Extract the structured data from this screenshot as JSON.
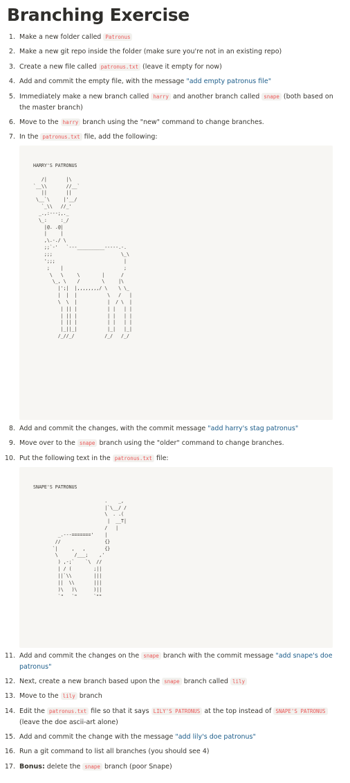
{
  "title": "Branching Exercise",
  "steps": [
    {
      "number": "1.",
      "parts": [
        {
          "t": "Make a new folder called "
        },
        {
          "t": "Patronus",
          "s": "code"
        }
      ]
    },
    {
      "number": "2.",
      "parts": [
        {
          "t": "Make a new git repo inside the folder (make sure you're not in an existing repo)"
        }
      ]
    },
    {
      "number": "3.",
      "parts": [
        {
          "t": "Create a new file called "
        },
        {
          "t": "patronus.txt",
          "s": "code"
        },
        {
          "t": " (leave it empty for now)"
        }
      ]
    },
    {
      "number": "4.",
      "parts": [
        {
          "t": "Add and commit the empty file, with the message "
        },
        {
          "t": "\"add empty patronus file\"",
          "s": "quote"
        }
      ]
    },
    {
      "number": "5.",
      "parts": [
        {
          "t": "Immediately make a new branch called "
        },
        {
          "t": "harry",
          "s": "code"
        },
        {
          "t": " and another branch called "
        },
        {
          "t": "snape",
          "s": "code"
        },
        {
          "t": " (both based on the master branch)"
        }
      ]
    },
    {
      "number": "6.",
      "parts": [
        {
          "t": "Move to the "
        },
        {
          "t": "harry",
          "s": "code"
        },
        {
          "t": " branch using the \"new\" command to change branches."
        }
      ]
    },
    {
      "number": "7.",
      "parts": [
        {
          "t": "In the "
        },
        {
          "t": "patronus.txt",
          "s": "code"
        },
        {
          "t": " file, add the following:"
        }
      ]
    },
    {
      "number": "8.",
      "parts": [
        {
          "t": "Add and commit the changes, with the commit message "
        },
        {
          "t": "\"add harry's stag patronus\"",
          "s": "quote"
        }
      ]
    },
    {
      "number": "9.",
      "parts": [
        {
          "t": "Move over to the "
        },
        {
          "t": "snape",
          "s": "code"
        },
        {
          "t": " branch using the \"older\" command to change branches."
        }
      ]
    },
    {
      "number": "10.",
      "parts": [
        {
          "t": "Put the following text in  the "
        },
        {
          "t": "patronus.txt",
          "s": "code"
        },
        {
          "t": " file:"
        }
      ]
    },
    {
      "number": "11.",
      "parts": [
        {
          "t": "Add and commit the changes on the "
        },
        {
          "t": "snape",
          "s": "code"
        },
        {
          "t": " branch with the commit message "
        },
        {
          "t": "\"add snape's doe patronus\"",
          "s": "quote"
        }
      ]
    },
    {
      "number": "12.",
      "parts": [
        {
          "t": "Next, create a new branch based upon the "
        },
        {
          "t": "snape",
          "s": "code"
        },
        {
          "t": " branch called "
        },
        {
          "t": "lily",
          "s": "code"
        }
      ]
    },
    {
      "number": "13.",
      "parts": [
        {
          "t": "Move to the "
        },
        {
          "t": "lily",
          "s": "code"
        },
        {
          "t": " branch"
        }
      ]
    },
    {
      "number": "14.",
      "parts": [
        {
          "t": "Edit the "
        },
        {
          "t": "patronus.txt",
          "s": "code"
        },
        {
          "t": " file so that it says "
        },
        {
          "t": "LILY'S PATRONUS",
          "s": "code"
        },
        {
          "t": " at the top instead of "
        },
        {
          "t": "SNAPE'S PATRONUS",
          "s": "code"
        },
        {
          "t": " (leave the doe ascii-art alone)"
        }
      ]
    },
    {
      "number": "15.",
      "parts": [
        {
          "t": "Add and commit the change with the message "
        },
        {
          "t": "\"add lily's doe patronus\"",
          "s": "quote"
        }
      ]
    },
    {
      "number": "16.",
      "parts": [
        {
          "t": "Run a git command to list all branches (you should see 4)"
        }
      ]
    },
    {
      "number": "17.",
      "parts": [
        {
          "t": "Bonus:",
          "s": "bold"
        },
        {
          "t": " delete the "
        },
        {
          "t": "snape",
          "s": "code"
        },
        {
          "t": " branch (poor Snape)"
        }
      ]
    }
  ],
  "code_blocks": [
    {
      "text": "HARRY'S PATRONUS\n\n   /|       |\\\n`__\\\\       //__`\n   ||       ||\n \\__`\\     |'__/\n   `_\\\\   //_'\n  _.,:---;,._\n  \\_:     :_/\n    |@. .@|\n    |     |\n    ,\\.-./ \\\n    ;;`-'   `---__________-----.-.\n    ;;;                         \\_\\\n    ';;;                         |\n     ;    |                      ;\n      \\   \\     \\        |      /\n       \\_, \\    /        \\     |\\\n         |';|  |,,,,,,,,/ \\    \\ \\_\n         |  |  |           \\   /   |\n         \\  \\  |           |  / \\  |\n          | || |           | |   | |\n          | || |           | |   | |\n          | || |           | |   | |\n          |_||_|           |_|   |_|\n         /_//_/           /_/   /_/"
    },
    {
      "text": "SNAPE'S PATRONUS\n\n                          .    _,\n                          |`\\__/ /\n                          \\  . .(\n                           |  __T|\n                          /   |\n         _.---======='    |\n        //                {}\n       `|     ,   ,       {}\n        \\      /___;    ,'\n         ) ,-;`    `\\  //\n         | / (        ;||\n         ||`\\\\        |||\n         ||  \\\\       |||\n         )\\   )\\      )||\n         `\"   `\"      `\"\""
    }
  ]
}
